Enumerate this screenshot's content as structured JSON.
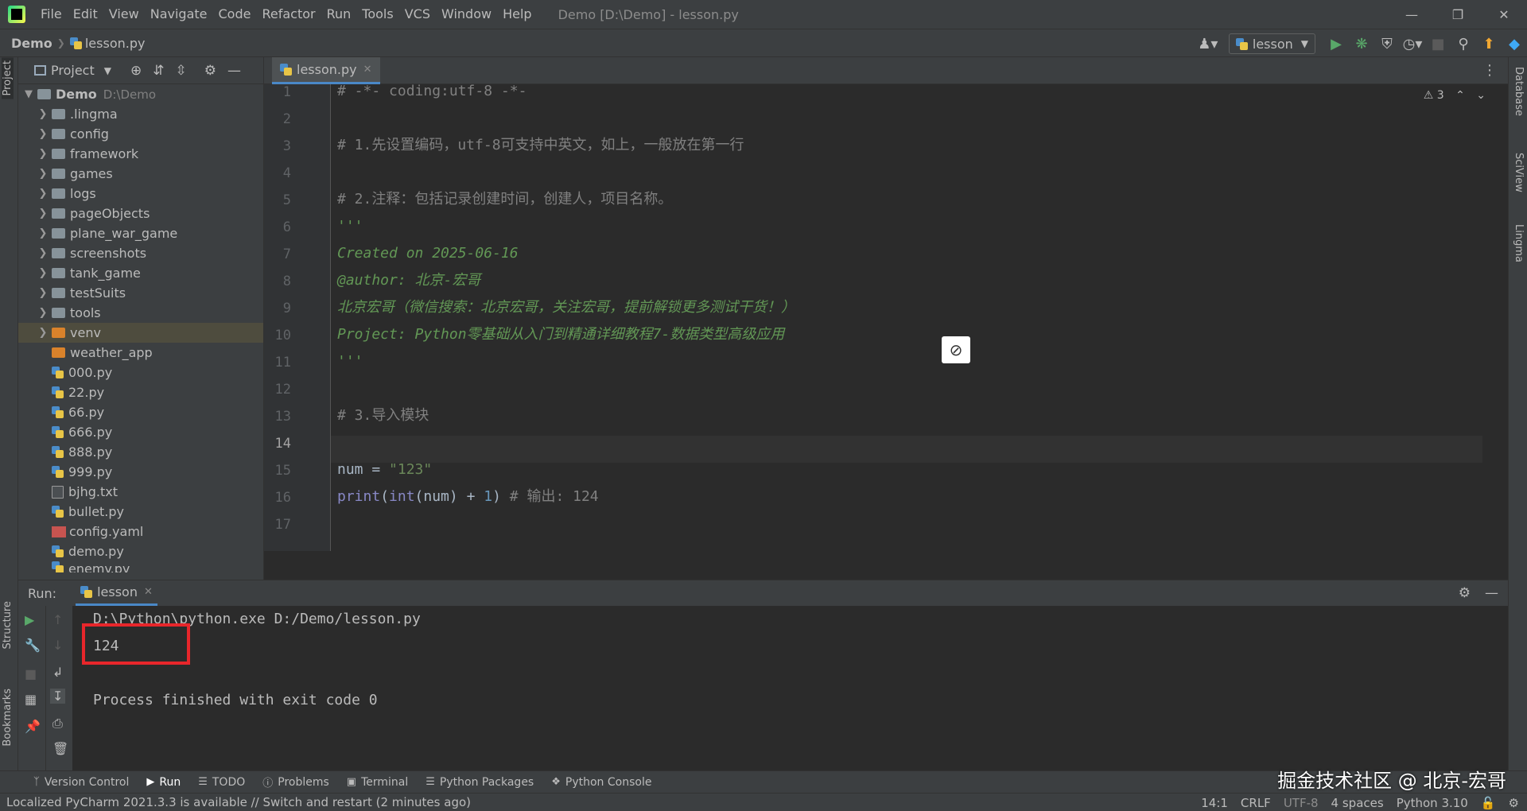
{
  "titlebar": {
    "menu": [
      "File",
      "Edit",
      "View",
      "Navigate",
      "Code",
      "Refactor",
      "Run",
      "Tools",
      "VCS",
      "Window",
      "Help"
    ],
    "window_title": "Demo [D:\\Demo] - lesson.py"
  },
  "navbar": {
    "project": "Demo",
    "file": "lesson.py",
    "run_config": "lesson"
  },
  "left_strip": {
    "project": "Project",
    "structure": "Structure",
    "bookmarks": "Bookmarks"
  },
  "right_strip": {
    "database": "Database",
    "sciview": "SciView",
    "lingma": "Lingma"
  },
  "project_panel": {
    "title": "Project",
    "root": {
      "name": "Demo",
      "path": "D:\\Demo"
    },
    "folders": [
      ".lingma",
      "config",
      "framework",
      "games",
      "logs",
      "pageObjects",
      "plane_war_game",
      "screenshots",
      "tank_game",
      "testSuits",
      "tools",
      "venv",
      "weather_app"
    ],
    "files": [
      "000.py",
      "22.py",
      "66.py",
      "666.py",
      "888.py",
      "999.py",
      "bjhg.txt",
      "bullet.py",
      "config.yaml",
      "demo.py",
      "enemy.py"
    ]
  },
  "editor": {
    "tab": "lesson.py",
    "inspection_count": "3",
    "line_numbers": [
      "1",
      "2",
      "3",
      "4",
      "5",
      "6",
      "7",
      "8",
      "9",
      "10",
      "11",
      "12",
      "13",
      "14",
      "15",
      "16",
      "17"
    ],
    "lines": {
      "l1": "# -*- coding:utf-8 -*-",
      "l3": "# 1.先设置编码，utf-8可支持中英文，如上，一般放在第一行",
      "l5": "# 2.注释：包括记录创建时间，创建人，项目名称。",
      "l6": "'''",
      "l7": "Created on 2025-06-16",
      "l8": "@author: 北京-宏哥",
      "l9": "北京宏哥（微信搜索：北京宏哥，关注宏哥，提前解锁更多测试干货！）",
      "l10": "Project: Python零基础从入门到精通详细教程7-数据类型高级应用",
      "l11": "'''",
      "l13": "# 3.导入模块",
      "l15_a": "num = ",
      "l15_b": "\"123\"",
      "l16_a": "print",
      "l16_b": "(",
      "l16_c": "int",
      "l16_d": "(num) + ",
      "l16_e": "1",
      "l16_f": ")",
      "l16_g": " # 输出: 124"
    }
  },
  "run_panel": {
    "label": "Run:",
    "tab": "lesson",
    "console": {
      "cmd": "D:\\Python\\python.exe D:/Demo/lesson.py",
      "output": "124",
      "finished": "Process finished with exit code 0"
    }
  },
  "toolwindows": [
    "Version Control",
    "Run",
    "TODO",
    "Problems",
    "Terminal",
    "Python Packages",
    "Python Console"
  ],
  "watermark": "掘金技术社区 @ 北京-宏哥",
  "statusbar": {
    "message": "Localized PyCharm 2021.3.3 is available // Switch and restart (2 minutes ago)",
    "position": "14:1",
    "line_sep": "CRLF",
    "encoding": "UTF-8",
    "indent": "4 spaces",
    "interpreter": "Python 3.10"
  }
}
